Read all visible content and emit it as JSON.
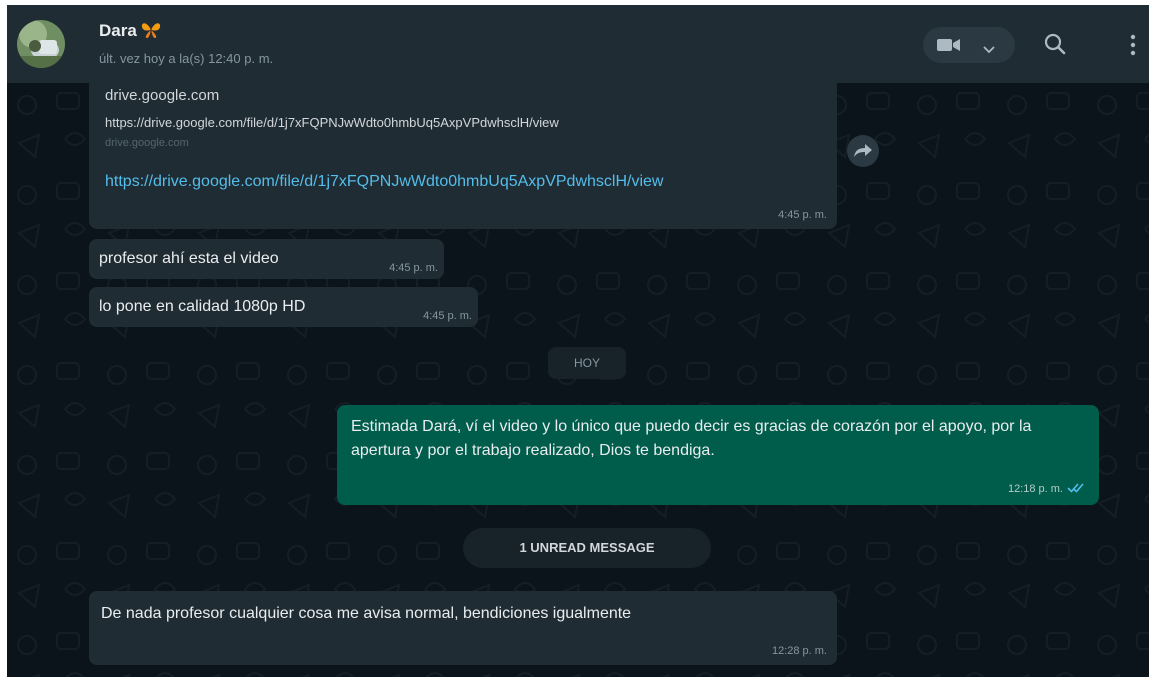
{
  "header": {
    "contact_name": "Dara",
    "contact_emoji": "🦋",
    "last_seen": "últ. vez hoy a la(s) 12:40 p. m.",
    "icons": {
      "video": "video-camera-icon",
      "dropdown": "chevron-down-icon",
      "search": "search-icon",
      "menu": "more-vertical-icon"
    }
  },
  "messages": {
    "link_preview": {
      "site": "drive.google.com",
      "url": "https://drive.google.com/file/d/1j7xFQPNJwWdto0hmbUq5AxpVPdwhsclH/view",
      "domain": "drive.google.com",
      "link_text": "https://drive.google.com/file/d/1j7xFQPNJwWdto0hmbUq5AxpVPdwhsclH/view",
      "time": "4:45 p. m."
    },
    "msg2": {
      "text": "profesor ahí esta el video",
      "time": "4:45 p. m."
    },
    "msg3": {
      "text": "lo pone en calidad 1080p HD",
      "time": "4:45 p. m."
    },
    "date_divider": "HOY",
    "outgoing": {
      "text": "Estimada Dará, ví el video y lo único que puedo decir es gracias de corazón por el apoyo, por la apertura y por el trabajo realizado, Dios te bendiga.",
      "time": "12:18 p. m.",
      "status": "read"
    },
    "unread_banner": "1 UNREAD MESSAGE",
    "last": {
      "text": "De nada profesor cualquier cosa me avisa normal, bendiciones igualmente",
      "time": "12:28 p. m."
    }
  },
  "colors": {
    "header_bg": "#202c33",
    "chat_bg": "#0b141a",
    "incoming_bubble": "#202c33",
    "outgoing_bubble": "#005c4b",
    "link": "#53bdeb",
    "read_ticks": "#53bdeb"
  }
}
